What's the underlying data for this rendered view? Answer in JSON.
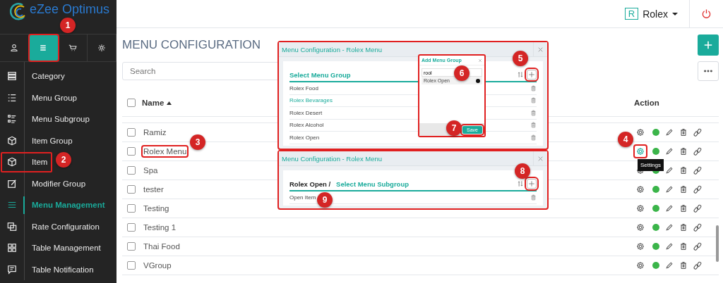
{
  "brand": "eZee Optimus",
  "top_tabs": [
    {
      "selected": false,
      "highlighted": false
    },
    {
      "selected": true,
      "highlighted": true
    },
    {
      "selected": false,
      "highlighted": false
    },
    {
      "selected": false,
      "highlighted": false
    }
  ],
  "sidebar": {
    "items": [
      {
        "label": "Category",
        "selected": false,
        "highlighted": false
      },
      {
        "label": "Menu Group",
        "selected": false,
        "highlighted": false
      },
      {
        "label": "Menu Subgroup",
        "selected": false,
        "highlighted": false
      },
      {
        "label": "Item Group",
        "selected": false,
        "highlighted": false
      },
      {
        "label": "Item",
        "selected": false,
        "highlighted": true
      },
      {
        "label": "Modifier Group",
        "selected": false,
        "highlighted": false
      },
      {
        "label": "Menu Management",
        "selected": true,
        "highlighted": false
      },
      {
        "label": "Rate Configuration",
        "selected": false,
        "highlighted": false
      },
      {
        "label": "Table Management",
        "selected": false,
        "highlighted": false
      },
      {
        "label": "Table Notification",
        "selected": false,
        "highlighted": false
      }
    ]
  },
  "header": {
    "property_badge": "R",
    "property": "Rolex"
  },
  "page_title": "MENU CONFIGURATION",
  "search": {
    "placeholder": "Search"
  },
  "table": {
    "columns": [
      "Name",
      "Action"
    ],
    "select_all_checked": false,
    "rows": [
      {
        "name": "Ramiz",
        "checked": false,
        "name_highlighted": false,
        "settings_highlighted": false
      },
      {
        "name": "Rolex Menu",
        "checked": false,
        "name_highlighted": true,
        "settings_highlighted": true,
        "tooltip": "Settings"
      },
      {
        "name": "Spa",
        "checked": false,
        "name_highlighted": false,
        "settings_highlighted": false
      },
      {
        "name": "tester",
        "checked": false,
        "name_highlighted": false,
        "settings_highlighted": false
      },
      {
        "name": "Testing",
        "checked": false,
        "name_highlighted": false,
        "settings_highlighted": false
      },
      {
        "name": "Testing 1",
        "checked": false,
        "name_highlighted": false,
        "settings_highlighted": false
      },
      {
        "name": "Thai Food",
        "checked": false,
        "name_highlighted": false,
        "settings_highlighted": false
      },
      {
        "name": "VGroup",
        "checked": false,
        "name_highlighted": false,
        "settings_highlighted": false
      }
    ]
  },
  "dialogs": [
    {
      "title": "Menu Configuration - Rolex Menu",
      "heading": "Select Menu Group",
      "add_highlighted": true,
      "items": [
        {
          "label": "Rolex Food",
          "selected": false
        },
        {
          "label": "Rolex Bevarages",
          "selected": true
        },
        {
          "label": "Rolex Desert",
          "selected": false
        },
        {
          "label": "Rolex Alcohol",
          "selected": false
        },
        {
          "label": "Rolex Open",
          "selected": false
        }
      ]
    },
    {
      "title": "Menu Configuration - Rolex Menu",
      "breadcrumb": "Rolex Open /",
      "heading": "Select Menu Subgroup",
      "add_highlighted": true,
      "items": [
        {
          "label": "Open Item",
          "selected": false
        }
      ]
    }
  ],
  "add_dialog": {
    "title": "Add Menu Group",
    "search_value": "rool",
    "items": [
      {
        "label": "Rolex Open",
        "checked": true
      }
    ],
    "save_label": "Save",
    "save_highlighted": true
  },
  "markers": [
    "1",
    "2",
    "3",
    "4",
    "5",
    "6",
    "7",
    "8",
    "9"
  ]
}
